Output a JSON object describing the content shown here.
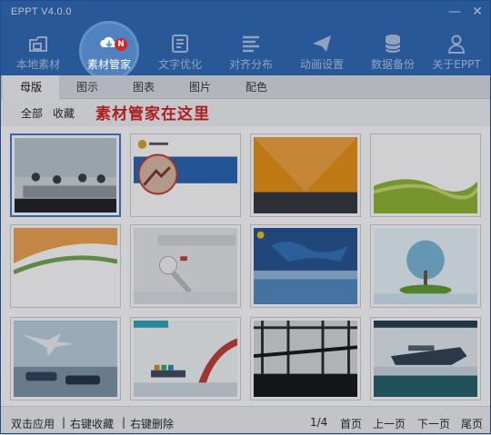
{
  "window": {
    "title": "EPPT V4.0.0"
  },
  "titlebar": {
    "minimize_icon": "minimize-icon",
    "close_icon": "close-icon",
    "close_glyph": "✕",
    "min_glyph": "—"
  },
  "toolbar": {
    "items": [
      {
        "label": "本地素材",
        "icon": "local-files-icon"
      },
      {
        "label": "素材管家",
        "icon": "cloud-download-icon",
        "badge": "N",
        "active": true
      },
      {
        "label": "文字优化",
        "icon": "text-doc-icon"
      },
      {
        "label": "对齐分布",
        "icon": "align-lines-icon"
      },
      {
        "label": "动画设置",
        "icon": "paper-plane-icon"
      },
      {
        "label": "数据备份",
        "icon": "database-icon"
      },
      {
        "label": "关于EPPT",
        "icon": "person-icon"
      }
    ]
  },
  "tabs": [
    {
      "label": "母版",
      "active": true
    },
    {
      "label": "图示"
    },
    {
      "label": "图表"
    },
    {
      "label": "图片"
    },
    {
      "label": "配色"
    }
  ],
  "filters": {
    "all": "全部",
    "favorites": "收藏"
  },
  "annotation": "素材管家在这里",
  "grid": {
    "thumbnails": [
      {
        "theme": "business-meeting",
        "selected": true
      },
      {
        "theme": "oil-industry-pumpjack"
      },
      {
        "theme": "orange-triangle"
      },
      {
        "theme": "green-wave"
      },
      {
        "theme": "orange-green-wave"
      },
      {
        "theme": "3d-figure-gray"
      },
      {
        "theme": "world-map-sea"
      },
      {
        "theme": "tree-on-island"
      },
      {
        "theme": "plane-and-car"
      },
      {
        "theme": "cargo-ship-bridge"
      },
      {
        "theme": "bridge-dark"
      },
      {
        "theme": "cruise-ship"
      }
    ]
  },
  "statusbar": {
    "hint_apply": "双击应用",
    "hint_fav": "右键收藏",
    "hint_delete": "右键删除",
    "sep": "|",
    "page": "1/4",
    "first": "首页",
    "prev": "上一页",
    "next": "下一页",
    "last": "尾页"
  },
  "colors": {
    "accent": "#2a66b5",
    "annotation": "#d31b1b",
    "badge": "#d62727"
  }
}
